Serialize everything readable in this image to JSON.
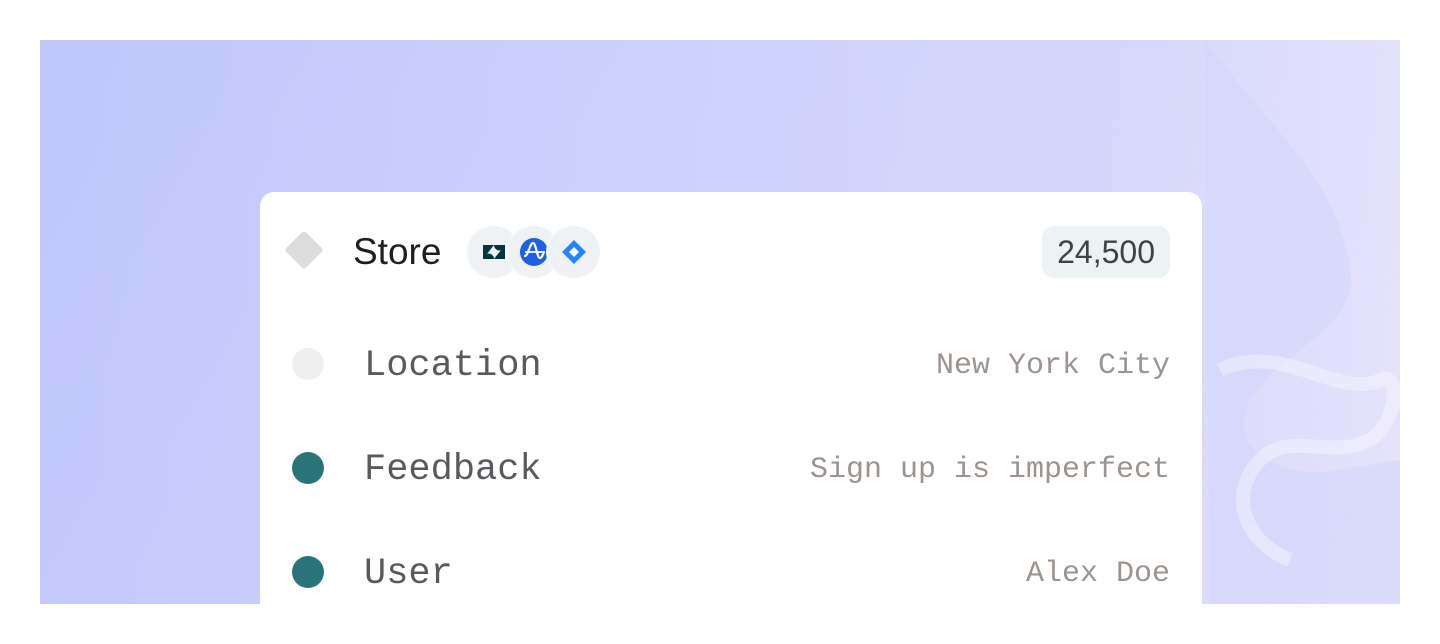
{
  "card": {
    "title": "Store",
    "count": "24,500",
    "integrations": [
      "zendesk-icon",
      "amplitude-icon",
      "jira-icon"
    ],
    "fields": [
      {
        "label": "Location",
        "value": "New York City",
        "status": "inactive"
      },
      {
        "label": "Feedback",
        "value": "Sign up is imperfect",
        "status": "active"
      },
      {
        "label": "User",
        "value": "Alex Doe",
        "status": "active"
      }
    ]
  },
  "colors": {
    "active_dot": "#2b737b",
    "inactive_dot": "#efefef",
    "background_start": "#bfc7fb",
    "background_end": "#d6d1fb",
    "amplitude": "#1f5fe8",
    "jira": "#2684ff",
    "zendesk": "#03363d"
  }
}
